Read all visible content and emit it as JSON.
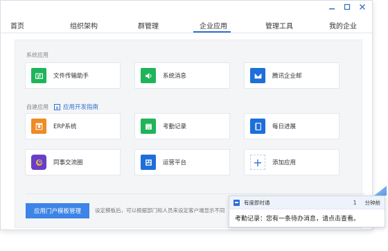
{
  "window": {
    "controls": [
      "minimize",
      "maximize",
      "close"
    ]
  },
  "nav": {
    "items": [
      "首页",
      "组织架构",
      "群管理",
      "企业应用",
      "管理工具",
      "我的企业"
    ],
    "active": "企业应用"
  },
  "sections": {
    "system_label": "系统应用",
    "custom_label": "自建应用",
    "dev_guide": "应用开发指南"
  },
  "system_apps": [
    {
      "label": "文件传输助手",
      "color": "#1fb45a",
      "icon": "file-transfer-icon"
    },
    {
      "label": "系统消息",
      "color": "#1fb45a",
      "icon": "speaker-icon"
    },
    {
      "label": "腾讯企业邮",
      "color": "#1e6fd9",
      "icon": "mail-icon"
    }
  ],
  "custom_apps": [
    {
      "label": "ERP系统",
      "color": "#f08a24",
      "icon": "erp-icon"
    },
    {
      "label": "考勤记录",
      "color": "#1fb45a",
      "icon": "calendar-icon"
    },
    {
      "label": "每日进展",
      "color": "#1e6fd9",
      "icon": "notebook-icon"
    },
    {
      "label": "同事交流圈",
      "color": "#6a3fc7",
      "icon": "circle-chat-icon"
    },
    {
      "label": "运营平台",
      "color": "#1e6fd9",
      "icon": "dashboard-icon"
    },
    {
      "label": "添加应用",
      "color": "#2f6fd6",
      "icon": "add-icon"
    }
  ],
  "bottom": {
    "portal_button": "应用门户模板管理",
    "portal_desc": "设定模板后，可以根据部门和人员来设定客户端显示不同"
  },
  "notification": {
    "app": "有度即时通",
    "count": "1",
    "time": "分钟前",
    "message": "考勤记录：您有一条待办消息，请点击查看。"
  }
}
